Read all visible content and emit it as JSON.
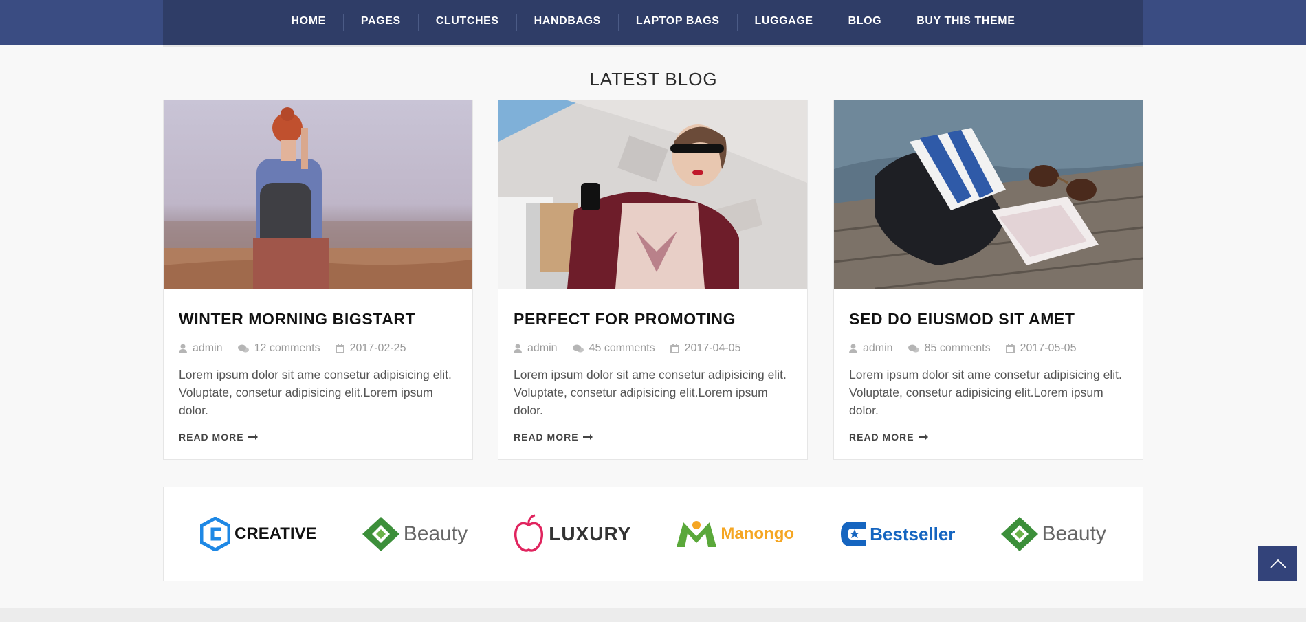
{
  "nav": {
    "items": [
      {
        "label": "HOME"
      },
      {
        "label": "PAGES"
      },
      {
        "label": "CLUTCHES"
      },
      {
        "label": "HANDBAGS"
      },
      {
        "label": "LAPTOP BAGS"
      },
      {
        "label": "LUGGAGE"
      },
      {
        "label": "BLOG"
      },
      {
        "label": "BUY THIS THEME"
      }
    ]
  },
  "blog": {
    "title": "LATEST BLOG",
    "posts": [
      {
        "title": "WINTER MORNING BIGSTART",
        "author": "admin",
        "comments": "12 comments",
        "date": "2017-02-25",
        "excerpt": "Lorem ipsum dolor sit ame consetur adipisicing elit. Voluptate, consetur adipisicing elit.Lorem ipsum dolor.",
        "read_more": "READ MORE"
      },
      {
        "title": "PERFECT FOR PROMOTING",
        "author": "admin",
        "comments": "45 comments",
        "date": "2017-04-05",
        "excerpt": "Lorem ipsum dolor sit ame consetur adipisicing elit. Voluptate, consetur adipisicing elit.Lorem ipsum dolor.",
        "read_more": "READ MORE"
      },
      {
        "title": "SED DO EIUSMOD SIT AMET",
        "author": "admin",
        "comments": "85 comments",
        "date": "2017-05-05",
        "excerpt": "Lorem ipsum dolor sit ame consetur adipisicing elit. Voluptate, consetur adipisicing elit.Lorem ipsum dolor.",
        "read_more": "READ MORE"
      }
    ]
  },
  "brands": [
    {
      "name": "CREATIVE",
      "color": "#1e88e5"
    },
    {
      "name": "Beauty",
      "color": "#3c8f3a"
    },
    {
      "name": "LUXURY",
      "color": "#e0245e"
    },
    {
      "name": "Manongo",
      "color": "#f5a623"
    },
    {
      "name": "Bestseller",
      "color": "#1565c0"
    },
    {
      "name": "Beauty",
      "color": "#3c8f3a"
    }
  ],
  "colors": {
    "nav_bg": "#3a4c82",
    "nav_inner": "#2f3d67",
    "scroll_top": "#33437a"
  },
  "icons": {
    "author": "user-icon",
    "comments": "comments-icon",
    "date": "calendar-icon",
    "read_more": "arrow-right-icon",
    "scroll_top": "chevron-up-icon"
  }
}
